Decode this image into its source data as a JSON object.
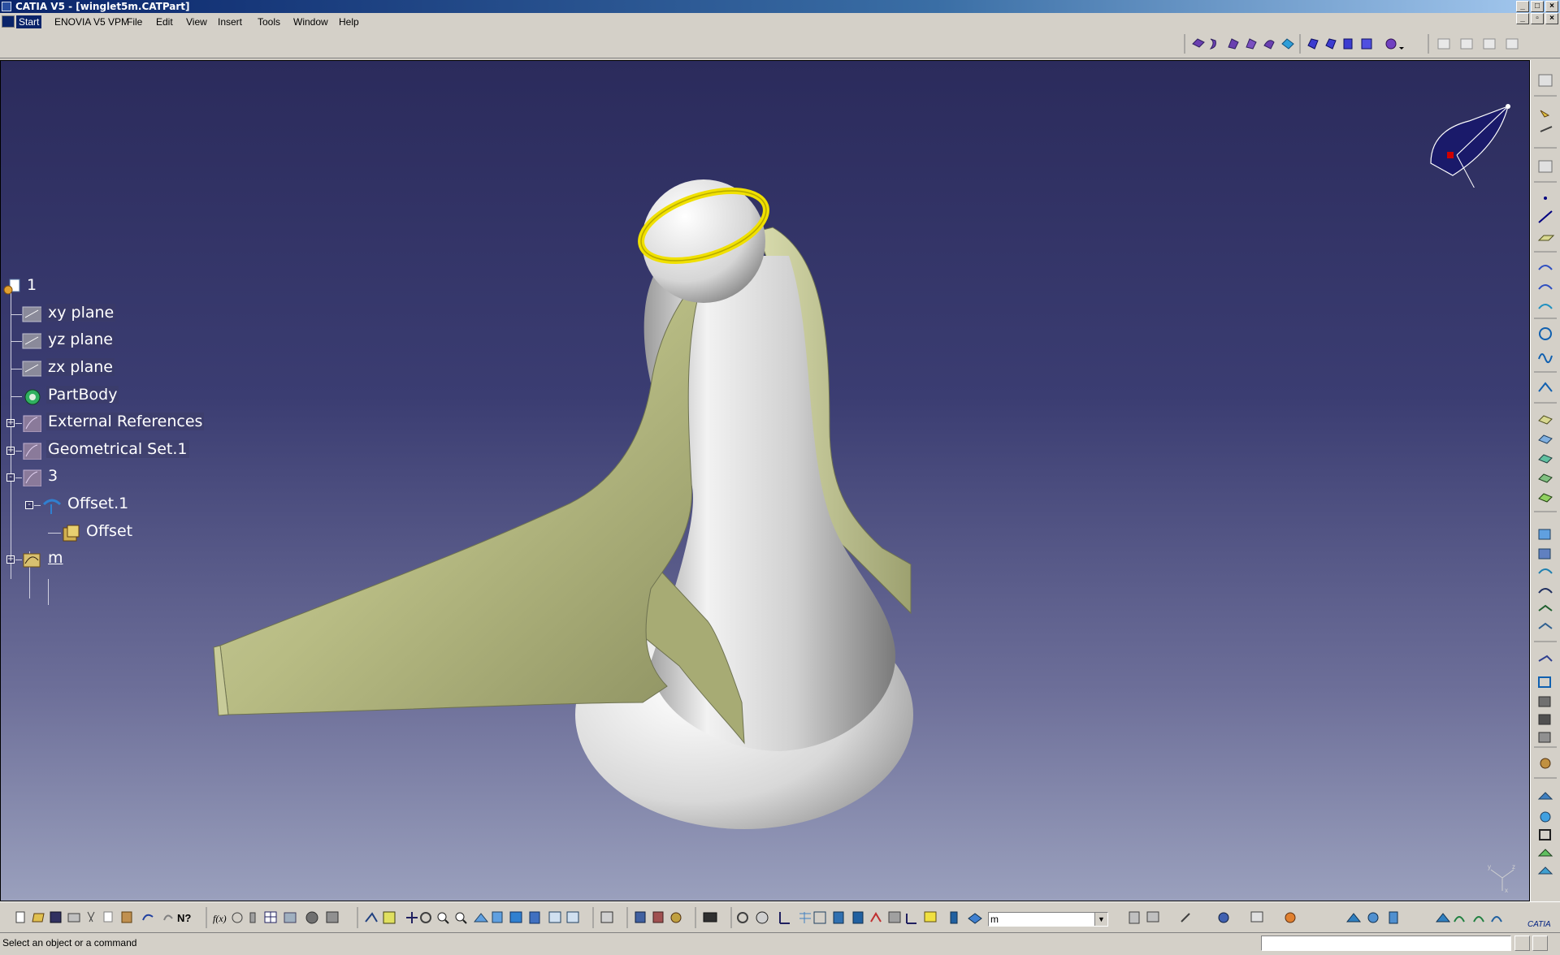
{
  "window": {
    "title": "CATIA V5 - [winglet5m.CATPart]",
    "controls": [
      "_",
      "□",
      "×"
    ]
  },
  "menu": {
    "items": [
      "Start",
      "ENOVIA V5 VPM",
      "File",
      "Edit",
      "View",
      "Insert",
      "Tools",
      "Window",
      "Help"
    ],
    "active": "Start"
  },
  "tree": {
    "root": "1",
    "nodes": [
      {
        "label": "xy plane",
        "icon": "plane-icon"
      },
      {
        "label": "yz plane",
        "icon": "plane-icon"
      },
      {
        "label": "zx plane",
        "icon": "plane-icon"
      },
      {
        "label": "PartBody",
        "icon": "partbody-icon"
      },
      {
        "label": "External References",
        "icon": "geometrical-set-icon",
        "expandable": "+"
      },
      {
        "label": "Geometrical Set.1",
        "icon": "geometrical-set-icon",
        "expandable": "+"
      },
      {
        "label": "3",
        "icon": "geometrical-set-icon",
        "expandable": "-"
      },
      {
        "label": "Offset.1",
        "icon": "offset-icon",
        "expandable": "-"
      },
      {
        "label": "Offset",
        "icon": "offset-param-icon"
      },
      {
        "label": "m",
        "icon": "law-icon",
        "expandable": "+"
      }
    ]
  },
  "toolbar": {
    "layer_value": "m"
  },
  "status": {
    "message": "Select an object or a command"
  },
  "colors": {
    "viewport_top": "#2b2b5c",
    "viewport_bottom": "#9aa0bd",
    "winglet_surface": "#b8bc84",
    "body_surface": "#e6e6e6",
    "halo": "#f0e000"
  }
}
